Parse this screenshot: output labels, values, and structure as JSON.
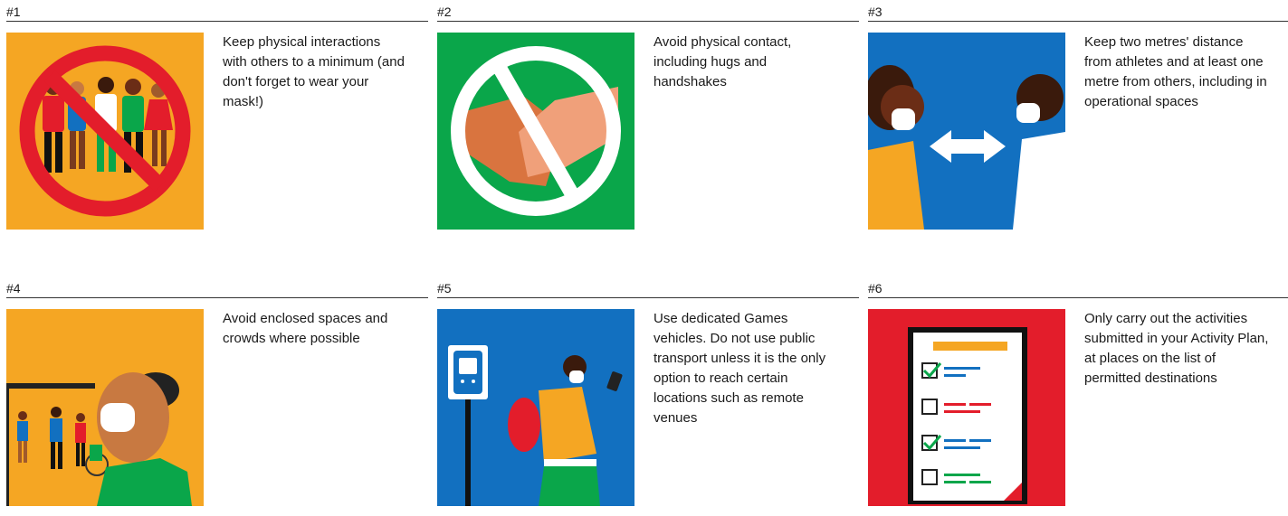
{
  "cards": [
    {
      "number": "#1",
      "text": "Keep physical interactions with others to a minimum (and don't forget to wear your mask!)",
      "bg": "#f5a623"
    },
    {
      "number": "#2",
      "text": "Avoid physical contact, including hugs and handshakes",
      "bg": "#0aa64a"
    },
    {
      "number": "#3",
      "text": "Keep two metres' distance from athletes and at least one metre from others, including in operational spaces",
      "bg": "#1270c0"
    },
    {
      "number": "#4",
      "text": "Avoid enclosed spaces and crowds where possible",
      "bg": "#f5a623"
    },
    {
      "number": "#5",
      "text": "Use dedicated Games vehicles. Do not use public transport unless it is the only option to reach certain locations such as remote venues",
      "bg": "#1270c0"
    },
    {
      "number": "#6",
      "text": "Only carry out the activities submitted in your Activity Plan, at places on the list of permitted destinations",
      "bg": "#e31d2b"
    }
  ]
}
